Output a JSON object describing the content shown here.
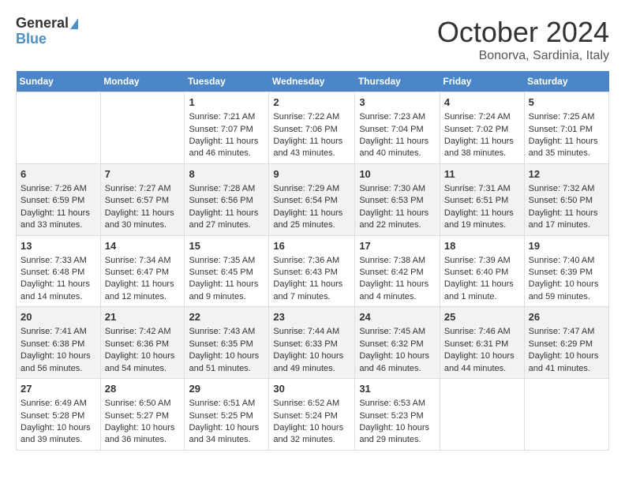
{
  "header": {
    "logo_line1": "General",
    "logo_line2": "Blue",
    "month": "October 2024",
    "location": "Bonorva, Sardinia, Italy"
  },
  "days_of_week": [
    "Sunday",
    "Monday",
    "Tuesday",
    "Wednesday",
    "Thursday",
    "Friday",
    "Saturday"
  ],
  "weeks": [
    [
      {
        "day": "",
        "data": ""
      },
      {
        "day": "",
        "data": ""
      },
      {
        "day": "1",
        "data": "Sunrise: 7:21 AM\nSunset: 7:07 PM\nDaylight: 11 hours and 46 minutes."
      },
      {
        "day": "2",
        "data": "Sunrise: 7:22 AM\nSunset: 7:06 PM\nDaylight: 11 hours and 43 minutes."
      },
      {
        "day": "3",
        "data": "Sunrise: 7:23 AM\nSunset: 7:04 PM\nDaylight: 11 hours and 40 minutes."
      },
      {
        "day": "4",
        "data": "Sunrise: 7:24 AM\nSunset: 7:02 PM\nDaylight: 11 hours and 38 minutes."
      },
      {
        "day": "5",
        "data": "Sunrise: 7:25 AM\nSunset: 7:01 PM\nDaylight: 11 hours and 35 minutes."
      }
    ],
    [
      {
        "day": "6",
        "data": "Sunrise: 7:26 AM\nSunset: 6:59 PM\nDaylight: 11 hours and 33 minutes."
      },
      {
        "day": "7",
        "data": "Sunrise: 7:27 AM\nSunset: 6:57 PM\nDaylight: 11 hours and 30 minutes."
      },
      {
        "day": "8",
        "data": "Sunrise: 7:28 AM\nSunset: 6:56 PM\nDaylight: 11 hours and 27 minutes."
      },
      {
        "day": "9",
        "data": "Sunrise: 7:29 AM\nSunset: 6:54 PM\nDaylight: 11 hours and 25 minutes."
      },
      {
        "day": "10",
        "data": "Sunrise: 7:30 AM\nSunset: 6:53 PM\nDaylight: 11 hours and 22 minutes."
      },
      {
        "day": "11",
        "data": "Sunrise: 7:31 AM\nSunset: 6:51 PM\nDaylight: 11 hours and 19 minutes."
      },
      {
        "day": "12",
        "data": "Sunrise: 7:32 AM\nSunset: 6:50 PM\nDaylight: 11 hours and 17 minutes."
      }
    ],
    [
      {
        "day": "13",
        "data": "Sunrise: 7:33 AM\nSunset: 6:48 PM\nDaylight: 11 hours and 14 minutes."
      },
      {
        "day": "14",
        "data": "Sunrise: 7:34 AM\nSunset: 6:47 PM\nDaylight: 11 hours and 12 minutes."
      },
      {
        "day": "15",
        "data": "Sunrise: 7:35 AM\nSunset: 6:45 PM\nDaylight: 11 hours and 9 minutes."
      },
      {
        "day": "16",
        "data": "Sunrise: 7:36 AM\nSunset: 6:43 PM\nDaylight: 11 hours and 7 minutes."
      },
      {
        "day": "17",
        "data": "Sunrise: 7:38 AM\nSunset: 6:42 PM\nDaylight: 11 hours and 4 minutes."
      },
      {
        "day": "18",
        "data": "Sunrise: 7:39 AM\nSunset: 6:40 PM\nDaylight: 11 hours and 1 minute."
      },
      {
        "day": "19",
        "data": "Sunrise: 7:40 AM\nSunset: 6:39 PM\nDaylight: 10 hours and 59 minutes."
      }
    ],
    [
      {
        "day": "20",
        "data": "Sunrise: 7:41 AM\nSunset: 6:38 PM\nDaylight: 10 hours and 56 minutes."
      },
      {
        "day": "21",
        "data": "Sunrise: 7:42 AM\nSunset: 6:36 PM\nDaylight: 10 hours and 54 minutes."
      },
      {
        "day": "22",
        "data": "Sunrise: 7:43 AM\nSunset: 6:35 PM\nDaylight: 10 hours and 51 minutes."
      },
      {
        "day": "23",
        "data": "Sunrise: 7:44 AM\nSunset: 6:33 PM\nDaylight: 10 hours and 49 minutes."
      },
      {
        "day": "24",
        "data": "Sunrise: 7:45 AM\nSunset: 6:32 PM\nDaylight: 10 hours and 46 minutes."
      },
      {
        "day": "25",
        "data": "Sunrise: 7:46 AM\nSunset: 6:31 PM\nDaylight: 10 hours and 44 minutes."
      },
      {
        "day": "26",
        "data": "Sunrise: 7:47 AM\nSunset: 6:29 PM\nDaylight: 10 hours and 41 minutes."
      }
    ],
    [
      {
        "day": "27",
        "data": "Sunrise: 6:49 AM\nSunset: 5:28 PM\nDaylight: 10 hours and 39 minutes."
      },
      {
        "day": "28",
        "data": "Sunrise: 6:50 AM\nSunset: 5:27 PM\nDaylight: 10 hours and 36 minutes."
      },
      {
        "day": "29",
        "data": "Sunrise: 6:51 AM\nSunset: 5:25 PM\nDaylight: 10 hours and 34 minutes."
      },
      {
        "day": "30",
        "data": "Sunrise: 6:52 AM\nSunset: 5:24 PM\nDaylight: 10 hours and 32 minutes."
      },
      {
        "day": "31",
        "data": "Sunrise: 6:53 AM\nSunset: 5:23 PM\nDaylight: 10 hours and 29 minutes."
      },
      {
        "day": "",
        "data": ""
      },
      {
        "day": "",
        "data": ""
      }
    ]
  ]
}
